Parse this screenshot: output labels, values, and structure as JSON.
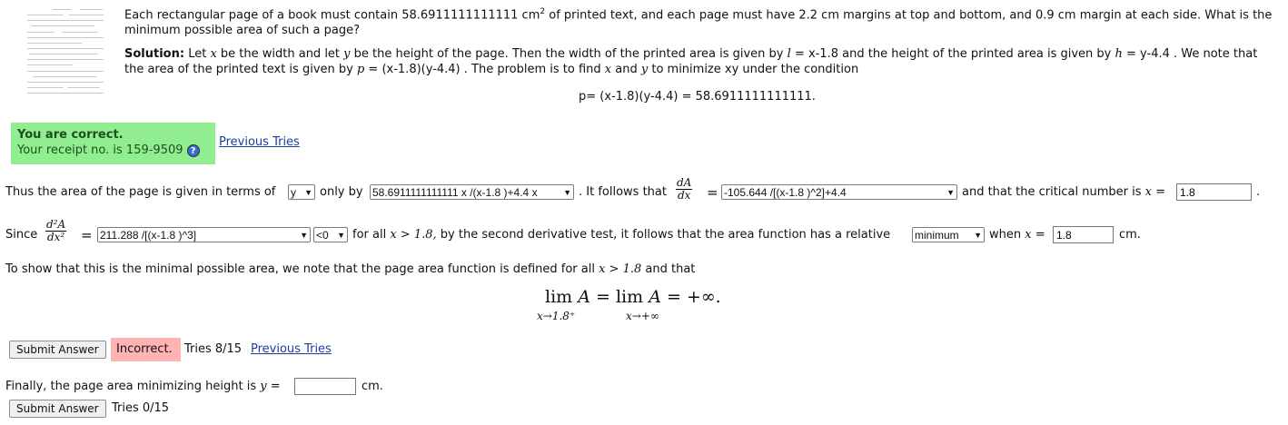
{
  "question": {
    "text_a": "Each rectangular page of a book must contain 58.6911111111111 cm",
    "sup": "2",
    "text_b": " of printed text, and each page must have 2.2 cm margins at top and bottom, and 0.9 cm margin at each side. What is the minimum possible area of such a page?"
  },
  "solution": {
    "label": "Solution:",
    "t1": " Let ",
    "x": "x",
    "t2": " be the width and let ",
    "y": "y",
    "t3": " be the height of the page. Then the width of the printed area is given by ",
    "l": "l",
    "t4": " = x-1.8 and the height of the printed area is given by ",
    "h": "h",
    "t5": " = y-4.4 . We note that the area of the printed text is given by ",
    "p": "p",
    "t6": " = (x-1.8)(y-4.4) . The problem is to find ",
    "t7": " and ",
    "t8": " to minimize xy under the condition",
    "equation": "p= (x-1.8)(y-4.4) = 58.6911111111111."
  },
  "feedback_correct": {
    "title": "You are correct.",
    "receipt": "Your receipt no. is 159-9509",
    "help_icon": "?",
    "previous_tries": "Previous Tries"
  },
  "line1": {
    "t1": "Thus the area of the page is given in terms of",
    "var_select": "y",
    "t2": "only by",
    "area_select": "58.6911111111111 x /(x-1.8 )+4.4 x",
    "t3": ". It follows that",
    "dA": "dA",
    "dx": "dx",
    "eq": "=",
    "deriv_select": "-105.644 /[(x-1.8 )^2]+4.4",
    "t4": "and that the critical number is",
    "xeq": "x",
    "eq2": "=",
    "critical_value": "1.8",
    "period": "."
  },
  "line2": {
    "since": "Since",
    "d2A": "d²A",
    "dx2": "dx²",
    "eq": "=",
    "second_deriv_select": "211.288 /[(x-1.8 )^3]",
    "sign_select": "<0",
    "t1": "for all",
    "cond": "x > 1.8,",
    "t2": "by the second derivative test, it follows that the area function has a relative",
    "extremum_select": "minimum",
    "t3": "when",
    "xeq": "x",
    "eq2": "=",
    "x_value": "1.8",
    "unit": "cm."
  },
  "line3": {
    "t1": "To show that this is the minimal possible area, we note that the page area function is defined for all",
    "cond": "x > 1.8",
    "t2": "and that"
  },
  "limit": {
    "lim1": "lim",
    "A1": "A",
    "eq1": "=",
    "lim2": "lim",
    "A2": "A",
    "eq2": "= +∞.",
    "sub1": "x→1.8⁺",
    "sub2": "x→+∞"
  },
  "submit1": {
    "button": "Submit Answer",
    "status": "Incorrect.",
    "tries": "Tries 8/15",
    "previous_tries": "Previous Tries"
  },
  "final": {
    "t1": "Finally, the page area minimizing height is",
    "yeq": "y",
    "eq": "=",
    "value": "",
    "unit": "cm."
  },
  "submit2": {
    "button": "Submit Answer",
    "tries": "Tries 0/15"
  },
  "colors": {
    "correct_bg": "#90ee90",
    "incorrect_bg": "#ffb3b3",
    "link": "#1a3d9a"
  }
}
